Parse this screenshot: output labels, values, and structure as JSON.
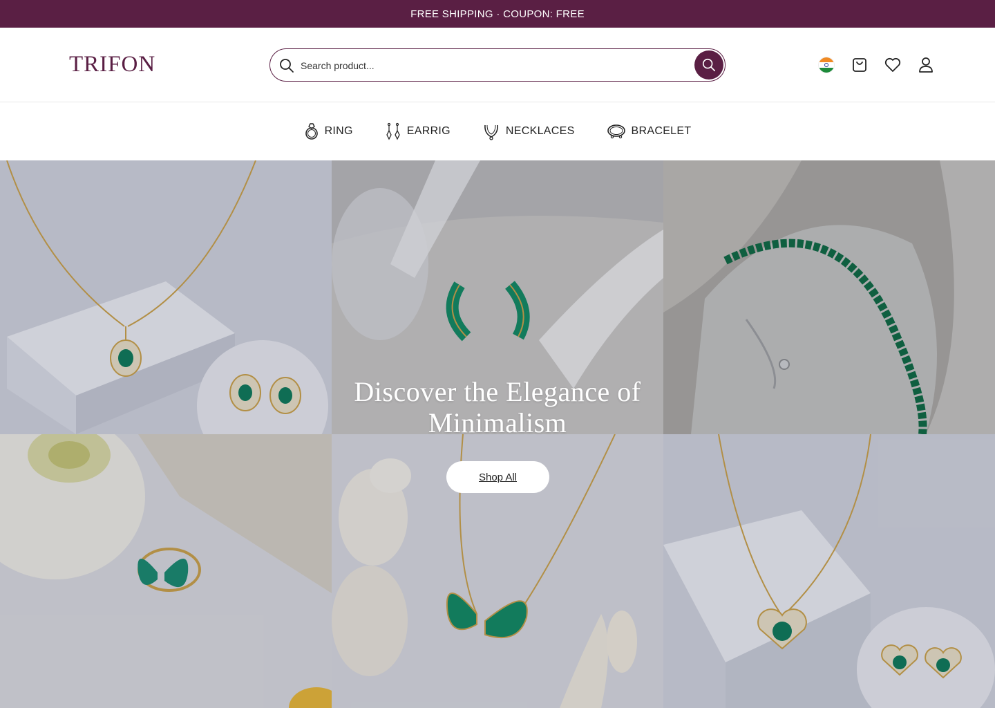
{
  "announcement": {
    "text": "FREE SHIPPING · COUPON: FREE"
  },
  "header": {
    "logo": "TRIFON",
    "search": {
      "placeholder": "Search product..."
    },
    "icons": [
      "india-flag-icon",
      "cart-icon",
      "wishlist-heart-icon",
      "user-account-icon"
    ]
  },
  "nav": {
    "items": [
      {
        "label": "RING",
        "icon": "ring-icon"
      },
      {
        "label": "EARRIG",
        "icon": "earring-icon"
      },
      {
        "label": "NECKLACES",
        "icon": "necklace-icon"
      },
      {
        "label": "BRACELET",
        "icon": "bracelet-icon"
      }
    ]
  },
  "hero": {
    "title": "Discover the Elegance of Minimalism",
    "button_label": "Shop All",
    "images": [
      "necklace-and-stud-earrings-photo",
      "baguette-hoop-earrings-photo",
      "tennis-bracelet-photo",
      "butterfly-ring-photo",
      "butterfly-necklace-photo",
      "heart-necklace-and-earrings-photo"
    ]
  },
  "colors": {
    "brand": "#5a1f44",
    "gem": "#0f7a5a",
    "gold": "#c9a14a"
  }
}
